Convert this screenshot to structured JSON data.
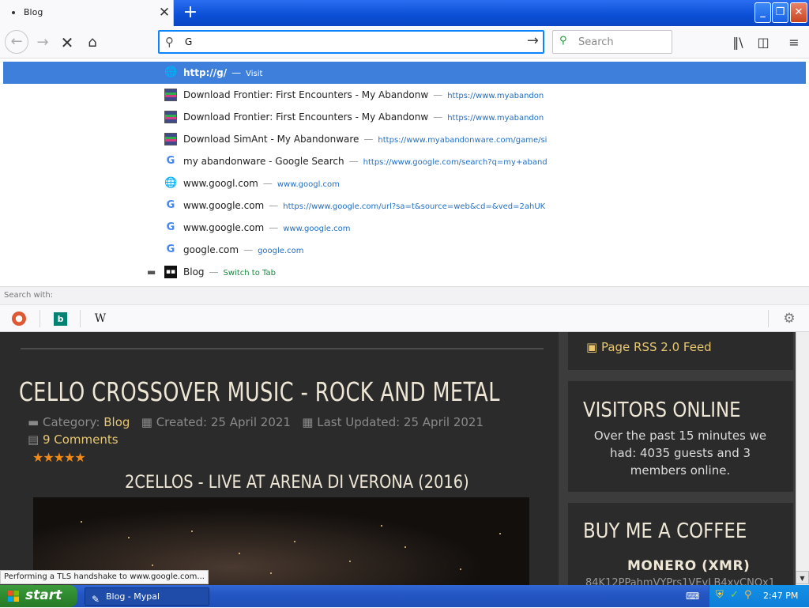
{
  "browser": {
    "tab_title": "Blog",
    "tab_close": "✕",
    "new_tab": "+",
    "url_value": "G",
    "search_placeholder": "Search"
  },
  "dropdown": {
    "items": [
      {
        "title": "http://g/",
        "sep": "—",
        "url": "Visit",
        "icon": "globe-icon"
      },
      {
        "title": "Download Frontier: First Encounters - My Abandonw",
        "sep": "—",
        "url": "https://www.myabandon",
        "icon": "abandonware-favicon"
      },
      {
        "title": "Download Frontier: First Encounters - My Abandonw",
        "sep": "—",
        "url": "https://www.myabandon",
        "icon": "abandonware-favicon"
      },
      {
        "title": "Download SimAnt - My Abandonware",
        "sep": "—",
        "url": "https://www.myabandonware.com/game/si",
        "icon": "abandonware-favicon"
      },
      {
        "title": "my abandonware - Google Search",
        "sep": "—",
        "url": "https://www.google.com/search?q=my+aband",
        "icon": "google-icon"
      },
      {
        "title": "www.googl.com",
        "sep": "—",
        "url": "www.googl.com",
        "icon": "globe-icon"
      },
      {
        "title": "www.google.com",
        "sep": "—",
        "url": "https://www.google.com/url?sa=t&source=web&cd=&ved=2ahUK",
        "icon": "google-icon"
      },
      {
        "title": "www.google.com",
        "sep": "—",
        "url": "www.google.com",
        "icon": "google-icon"
      },
      {
        "title": "google.com",
        "sep": "—",
        "url": "google.com",
        "icon": "google-icon"
      },
      {
        "title": "Blog",
        "sep": "—",
        "url": "Switch to Tab",
        "icon": "blog-favicon"
      }
    ],
    "search_with_label": "Search with:"
  },
  "page": {
    "article_title": "CELLO CROSSOVER MUSIC - ROCK AND METAL",
    "category_label": "Category:",
    "category": "Blog",
    "created": "Created: 25 April 2021",
    "updated": "Last Updated: 25 April 2021",
    "comments": "9 Comments",
    "stars": "★★★★★",
    "video_title": "2CELLOS - LIVE AT ARENA DI VERONA (2016)",
    "rss": "Page RSS 2.0 Feed",
    "visitors_title": "VISITORS ONLINE",
    "visitors_text": "Over the past 15 minutes we had: 4035 guests and 3 members online.",
    "coffee_title": "BUY ME A COFFEE",
    "monero_label": "MONERO (XMR)",
    "monero_address": "84K12PPahmVYPrs1VEvLB4xvCNQx1"
  },
  "status_text": "Performing a TLS handshake to www.google.com...",
  "taskbar": {
    "start": "start",
    "task_item": "Blog - Mypal",
    "clock": "2:47 PM"
  }
}
